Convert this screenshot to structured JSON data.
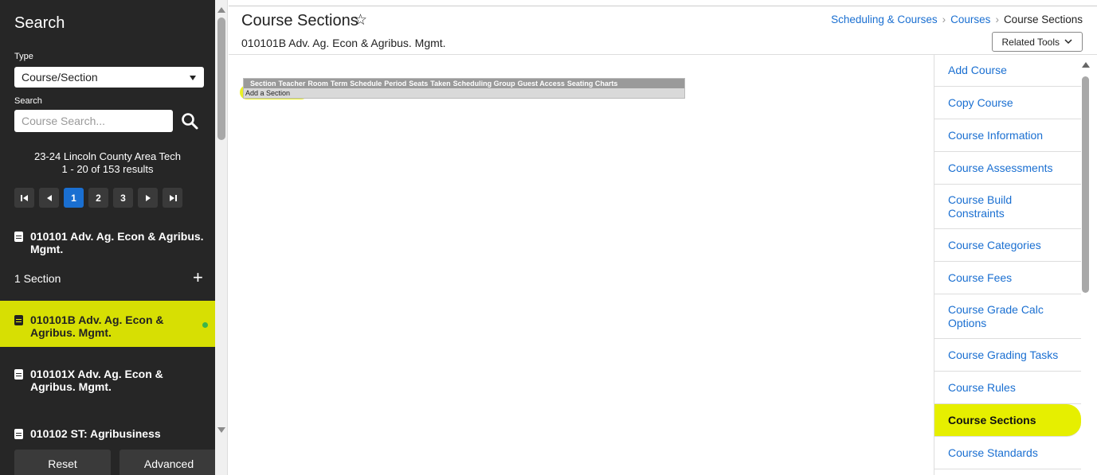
{
  "sidebar": {
    "title": "Search",
    "type_label": "Type",
    "type_value": "Course/Section",
    "search_label": "Search",
    "search_placeholder": "Course Search...",
    "school": "23-24 Lincoln County Area Tech",
    "results": "1 - 20 of 153 results",
    "pages": [
      "1",
      "2",
      "3"
    ],
    "active_page": "1",
    "items": [
      {
        "label": "010101 Adv. Ag. Econ & Agribus. Mgmt."
      },
      {
        "label": "010101B Adv. Ag. Econ & Agribus. Mgmt."
      },
      {
        "label": "010101X Adv. Ag. Econ & Agribus. Mgmt."
      },
      {
        "label": "010102 ST: Agribusiness"
      }
    ],
    "section_row": "1 Section",
    "reset_label": "Reset",
    "advanced_label": "Advanced"
  },
  "header": {
    "title": "Course Sections",
    "subtitle": "010101B Adv. Ag. Econ & Agribus. Mgmt.",
    "breadcrumbs": [
      "Scheduling & Courses",
      "Courses",
      "Course Sections"
    ],
    "related_tools": "Related Tools"
  },
  "sections_table": {
    "columns": [
      "Section",
      "Teacher",
      "Room",
      "Term",
      "Schedule",
      "Period",
      "Seats",
      "Taken",
      "Scheduling Group",
      "Guest Access",
      "Seating Charts"
    ],
    "add_label": "Add a Section"
  },
  "related_tools": [
    "Add Course",
    "Copy Course",
    "Course Information",
    "Course Assessments",
    "Course Build Constraints",
    "Course Categories",
    "Course Fees",
    "Course Grade Calc Options",
    "Course Grading Tasks",
    "Course Rules",
    "Course Sections",
    "Course Standards"
  ],
  "active_tool": "Course Sections",
  "colors": {
    "sidebar_bg": "#262626",
    "accent_blue": "#1a6fd1",
    "highlight": "#e6ef00",
    "status_dot": "#3bb54a"
  }
}
